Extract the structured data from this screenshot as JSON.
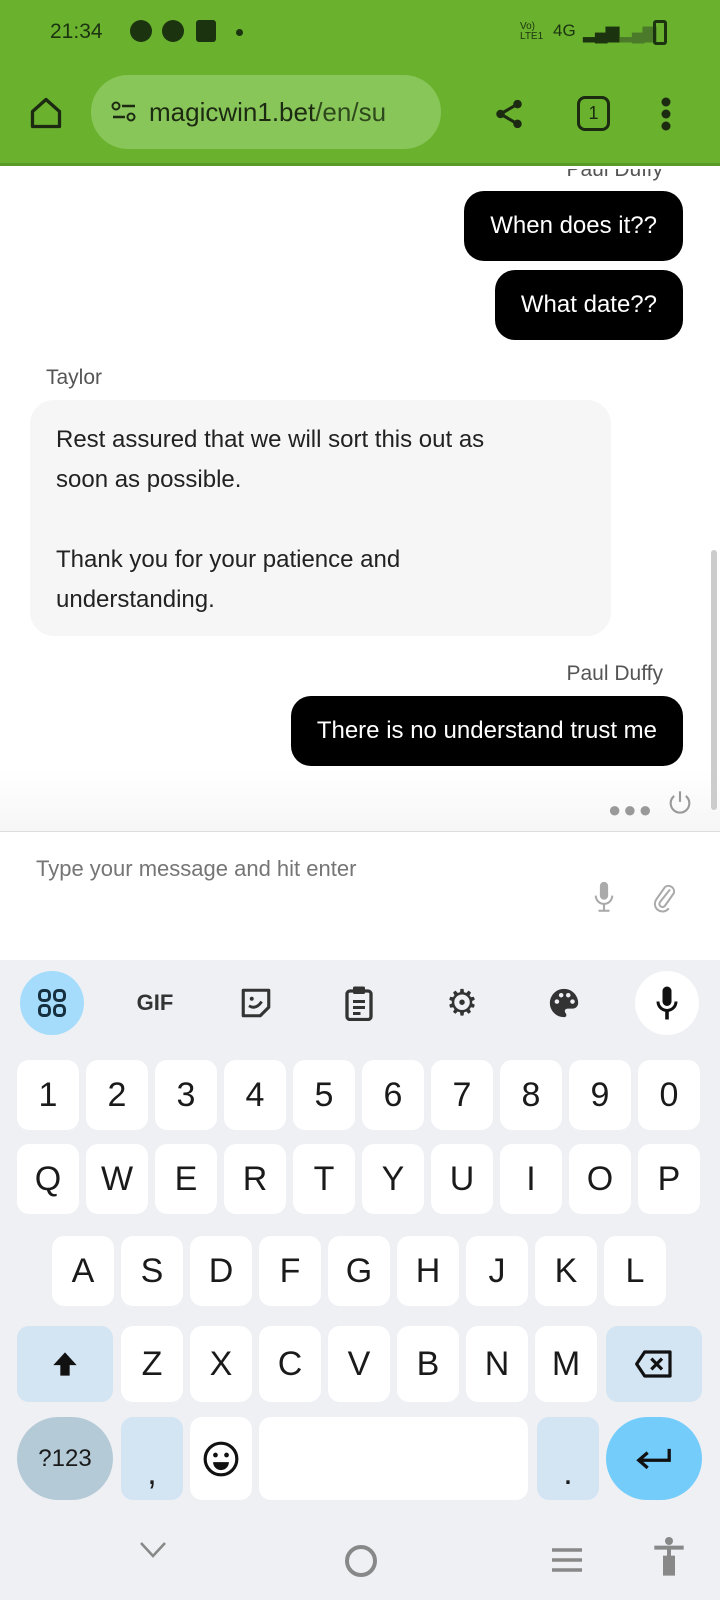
{
  "status_bar": {
    "time": "21:34",
    "network": "4G",
    "volte": "Vo) LTE1"
  },
  "browser": {
    "url_main": "magicwin1.bet",
    "url_rest": "/en/su",
    "tab_count": "1",
    "accent": "#6ab22e"
  },
  "chat": {
    "top_label": "Paul Duffy",
    "messages": [
      {
        "sender": "Paul Duffy",
        "text": "When does it??"
      },
      {
        "sender": "Paul Duffy",
        "text": "What date??"
      },
      {
        "sender": "Taylor",
        "label": "Taylor",
        "lines": [
          "Rest assured that we will sort this out as",
          "soon as possible.",
          "",
          "Thank you for your patience and",
          "understanding."
        ]
      },
      {
        "sender": "Paul Duffy",
        "label": "Paul Duffy",
        "text": "There is no understand trust me"
      }
    ]
  },
  "composer": {
    "placeholder": "Type your message and hit enter"
  },
  "keyboard": {
    "toolbar": {
      "gif": "GIF"
    },
    "rows": [
      [
        "1",
        "2",
        "3",
        "4",
        "5",
        "6",
        "7",
        "8",
        "9",
        "0"
      ],
      [
        "Q",
        "W",
        "E",
        "R",
        "T",
        "Y",
        "U",
        "I",
        "O",
        "P"
      ],
      [
        "A",
        "S",
        "D",
        "F",
        "G",
        "H",
        "J",
        "K",
        "L"
      ],
      [
        "Z",
        "X",
        "C",
        "V",
        "B",
        "N",
        "M"
      ]
    ],
    "symbols": "?123",
    "comma": ",",
    "period": "."
  }
}
